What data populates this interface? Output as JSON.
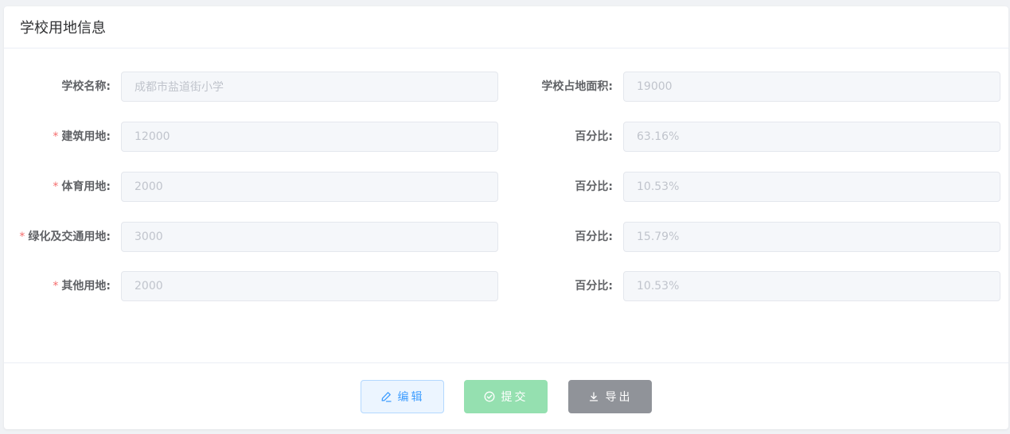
{
  "card": {
    "title": "学校用地信息"
  },
  "form": {
    "rows": [
      {
        "left": {
          "label": "学校名称:",
          "required": false,
          "value": "成都市盐道街小学"
        },
        "right": {
          "label": "学校占地面积:",
          "required": false,
          "value": "19000"
        }
      },
      {
        "left": {
          "label": "建筑用地:",
          "required": true,
          "value": "12000"
        },
        "right": {
          "label": "百分比:",
          "required": false,
          "value": "63.16%"
        }
      },
      {
        "left": {
          "label": "体育用地:",
          "required": true,
          "value": "2000"
        },
        "right": {
          "label": "百分比:",
          "required": false,
          "value": "10.53%"
        }
      },
      {
        "left": {
          "label": "绿化及交通用地:",
          "required": true,
          "value": "3000"
        },
        "right": {
          "label": "百分比:",
          "required": false,
          "value": "15.79%"
        }
      },
      {
        "left": {
          "label": "其他用地:",
          "required": true,
          "value": "2000"
        },
        "right": {
          "label": "百分比:",
          "required": false,
          "value": "10.53%"
        }
      }
    ],
    "required_mark": "*"
  },
  "footer": {
    "edit_label": "编辑",
    "edit_icon": "edit-pen-icon",
    "submit_label": "提交",
    "submit_icon": "circle-check-icon",
    "export_label": "导出",
    "export_icon": "download-icon"
  },
  "colors": {
    "primary": "#409eff",
    "success_disabled": "#95e0b0",
    "info": "#909399",
    "danger": "#f56c6c"
  }
}
